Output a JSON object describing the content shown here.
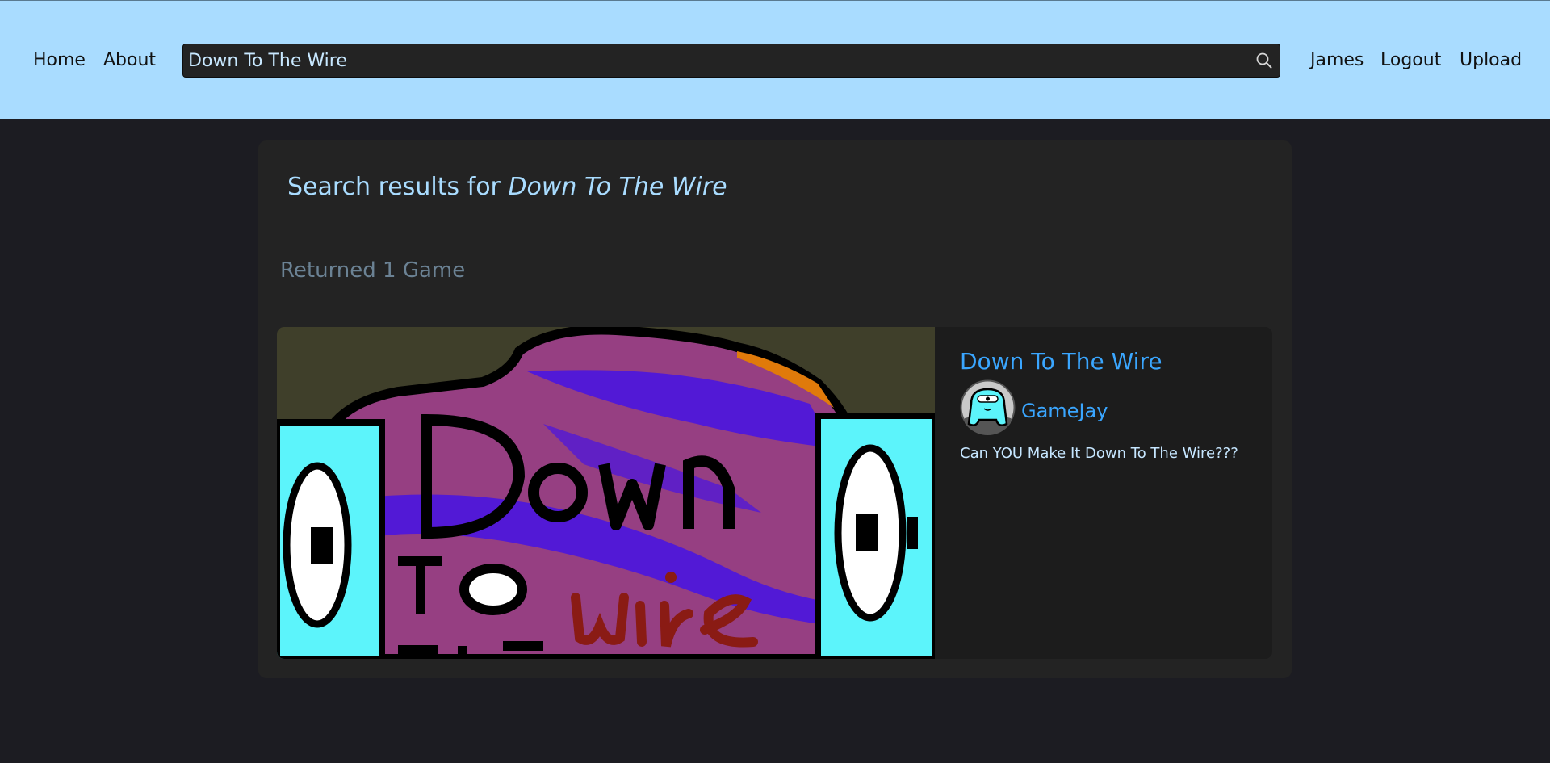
{
  "nav": {
    "home": "Home",
    "about": "About",
    "user": "James",
    "logout": "Logout",
    "upload": "Upload"
  },
  "search": {
    "value": "Down To The Wire",
    "icon": "search-icon"
  },
  "results": {
    "heading_prefix": "Search results for ",
    "query": "Down To The Wire",
    "count_text": "Returned 1 Game"
  },
  "games": [
    {
      "title": "Down To The Wire",
      "author": "GameJay",
      "description": "Can YOU Make It Down To The Wire???",
      "thumbnail_text": "Down to the wire"
    }
  ],
  "colors": {
    "header_bg": "#a9dcff",
    "page_bg": "#1c1c22",
    "panel_bg": "#232323",
    "link": "#3aa6ff"
  }
}
